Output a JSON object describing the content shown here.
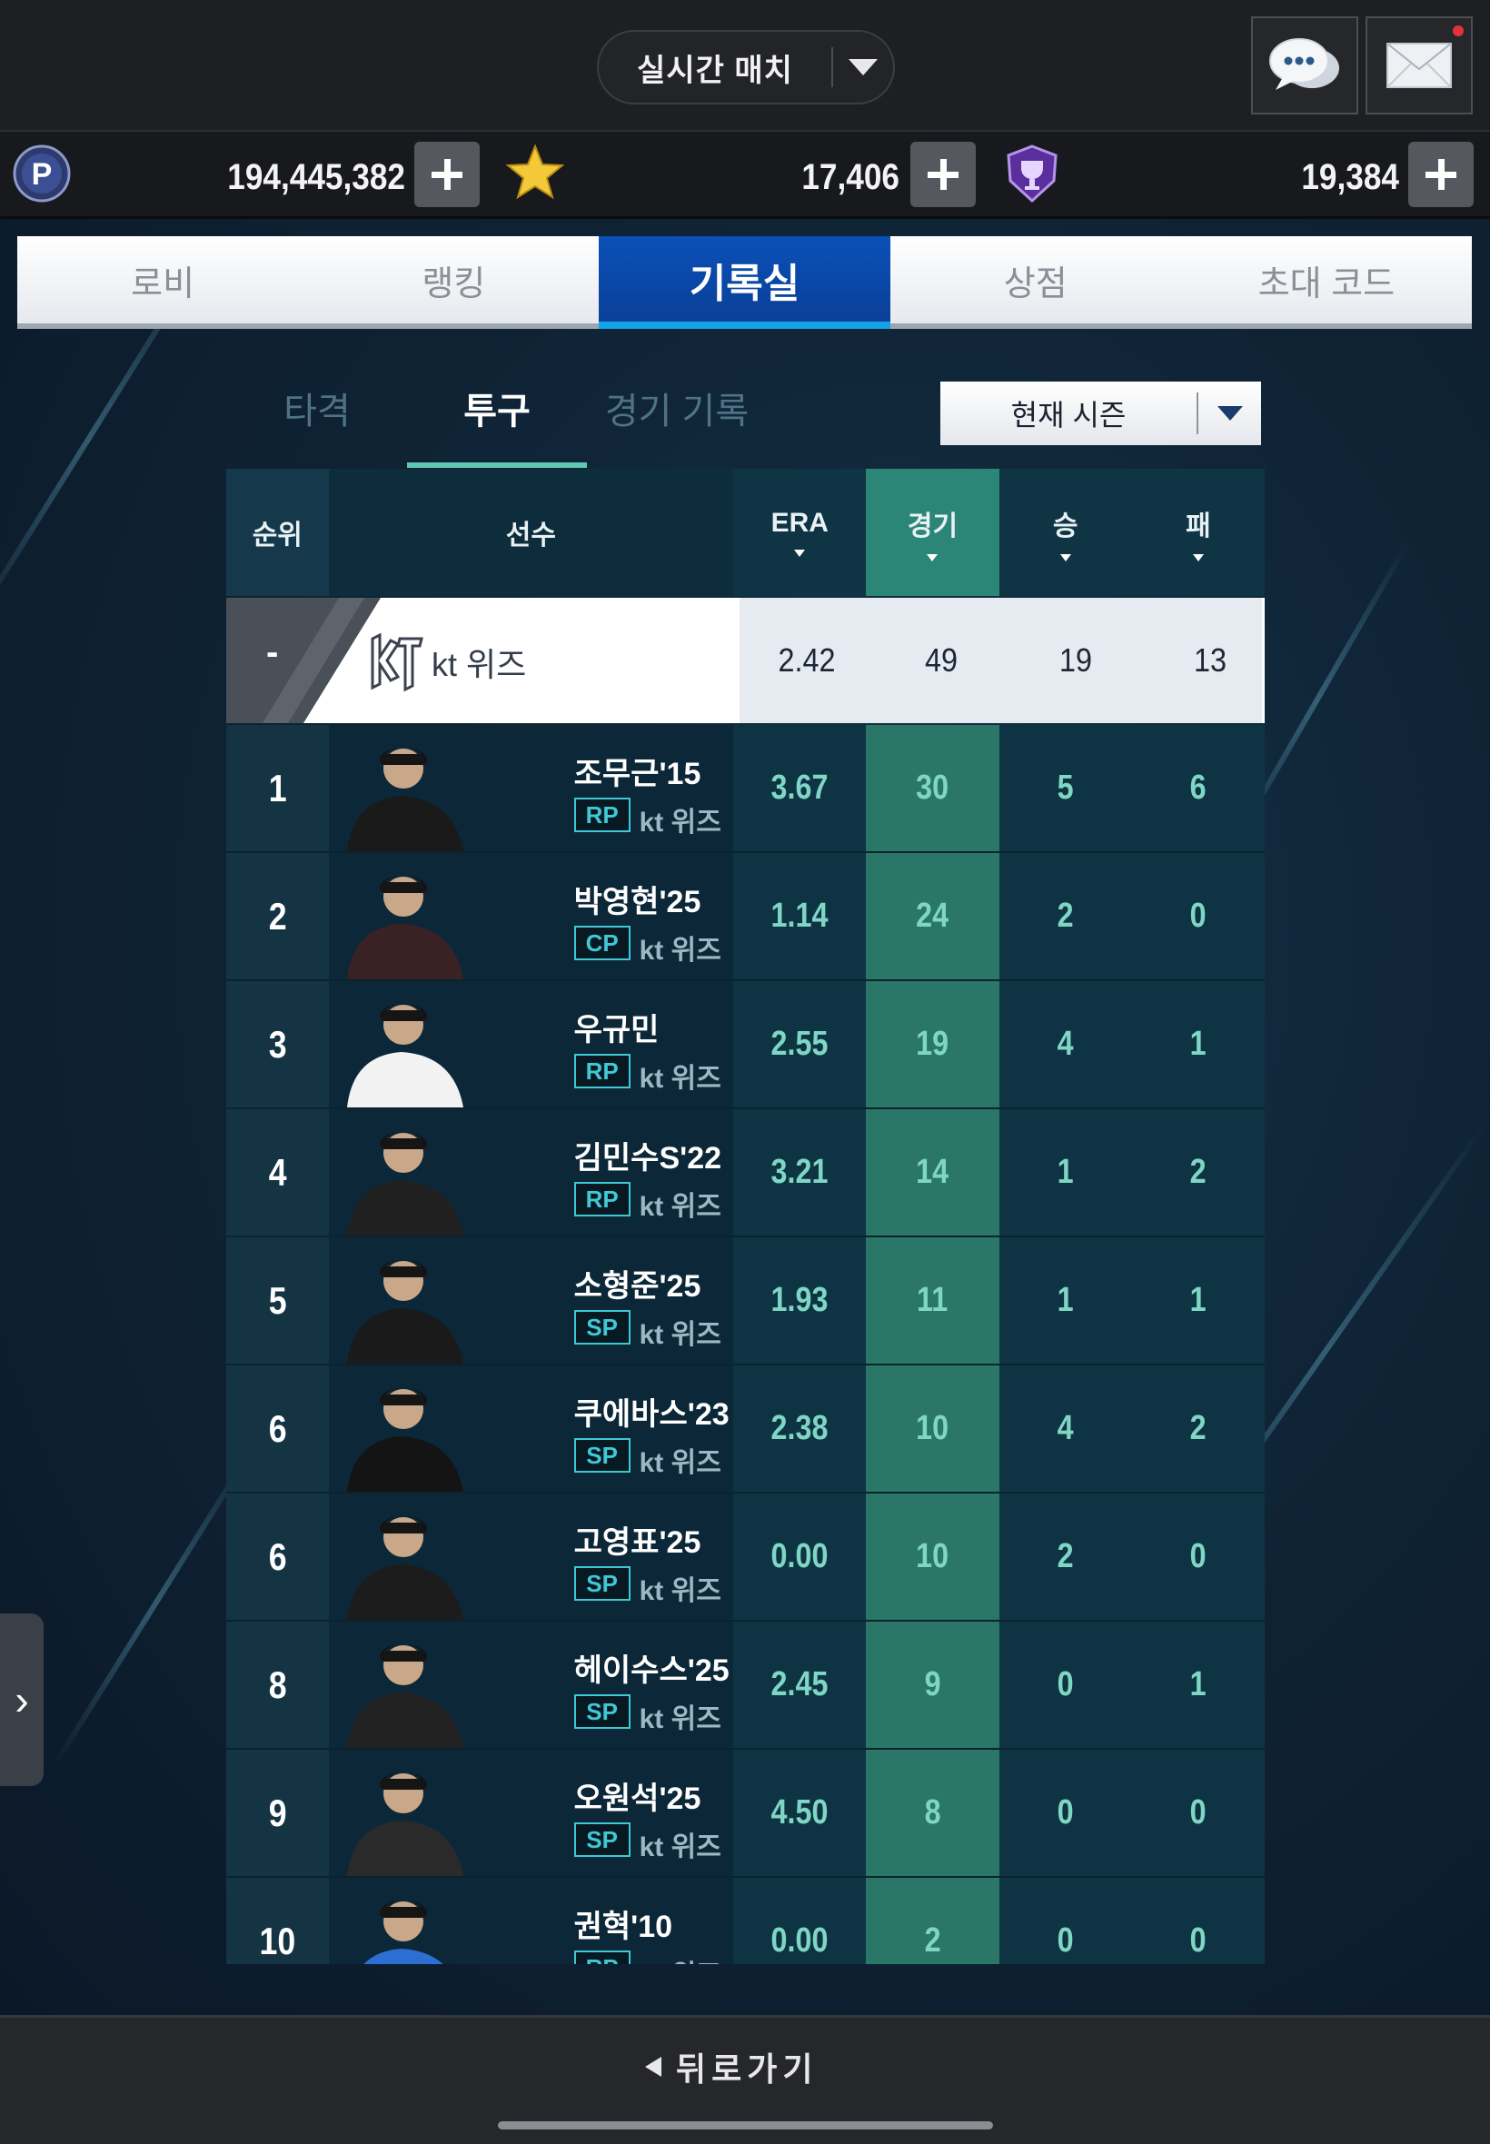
{
  "header": {
    "mode_label": "실시간 매치",
    "chat_icon": "chat-bubble-icon",
    "mail_icon": "mail-envelope-icon"
  },
  "currencies": [
    {
      "icon": "p-coin-icon",
      "amount": "194,445,382"
    },
    {
      "icon": "star-icon",
      "amount": "17,406"
    },
    {
      "icon": "trophy-shield-icon",
      "amount": "19,384"
    }
  ],
  "main_tabs": [
    {
      "label": "로비",
      "active": false
    },
    {
      "label": "랭킹",
      "active": false
    },
    {
      "label": "기록실",
      "active": true
    },
    {
      "label": "상점",
      "active": false
    },
    {
      "label": "초대 코드",
      "active": false
    }
  ],
  "sub_tabs": [
    {
      "label": "타격",
      "active": false
    },
    {
      "label": "투구",
      "active": true
    },
    {
      "label": "경기 기록",
      "active": false
    }
  ],
  "season_select": {
    "label": "현재 시즌"
  },
  "table": {
    "columns": {
      "rank": "순위",
      "player": "선수",
      "era": "ERA",
      "games": "경기",
      "wins": "승",
      "losses": "패"
    },
    "sorted_column": "경기",
    "team_row": {
      "rank": "-",
      "team": "kt 위즈",
      "era": "2.42",
      "games": "49",
      "wins": "19",
      "losses": "13"
    },
    "rows": [
      {
        "rank": "1",
        "name": "조무근'15",
        "pos": "RP",
        "team": "kt 위즈",
        "era": "3.67",
        "games": "30",
        "wins": "5",
        "losses": "6"
      },
      {
        "rank": "2",
        "name": "박영현'25",
        "pos": "CP",
        "team": "kt 위즈",
        "era": "1.14",
        "games": "24",
        "wins": "2",
        "losses": "0"
      },
      {
        "rank": "3",
        "name": "우규민",
        "pos": "RP",
        "team": "kt 위즈",
        "era": "2.55",
        "games": "19",
        "wins": "4",
        "losses": "1"
      },
      {
        "rank": "4",
        "name": "김민수S'22",
        "pos": "RP",
        "team": "kt 위즈",
        "era": "3.21",
        "games": "14",
        "wins": "1",
        "losses": "2"
      },
      {
        "rank": "5",
        "name": "소형준'25",
        "pos": "SP",
        "team": "kt 위즈",
        "era": "1.93",
        "games": "11",
        "wins": "1",
        "losses": "1"
      },
      {
        "rank": "6",
        "name": "쿠에바스'23",
        "pos": "SP",
        "team": "kt 위즈",
        "era": "2.38",
        "games": "10",
        "wins": "4",
        "losses": "2"
      },
      {
        "rank": "6",
        "name": "고영표'25",
        "pos": "SP",
        "team": "kt 위즈",
        "era": "0.00",
        "games": "10",
        "wins": "2",
        "losses": "0"
      },
      {
        "rank": "8",
        "name": "헤이수스'25",
        "pos": "SP",
        "team": "kt 위즈",
        "era": "2.45",
        "games": "9",
        "wins": "0",
        "losses": "1"
      },
      {
        "rank": "9",
        "name": "오원석'25",
        "pos": "SP",
        "team": "kt 위즈",
        "era": "4.50",
        "games": "8",
        "wins": "0",
        "losses": "0"
      },
      {
        "rank": "10",
        "name": "권혁'10",
        "pos": "RP",
        "team": "kt 위즈",
        "era": "0.00",
        "games": "2",
        "wins": "0",
        "losses": "0"
      }
    ]
  },
  "footer": {
    "back_label": "뒤로가기"
  },
  "colors": {
    "accent": "#0b4fb5",
    "highlight_column": "#2c8677",
    "stat_text": "#7fd6c5",
    "badge": "#40c8d4"
  }
}
